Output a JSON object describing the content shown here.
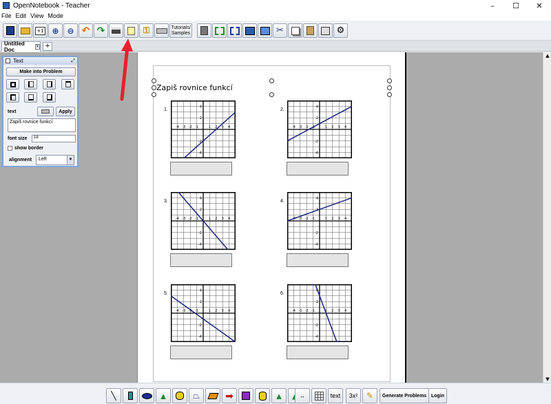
{
  "window": {
    "title": "OpenNotebook - Teacher",
    "controls": [
      "–",
      "☐",
      "✕"
    ]
  },
  "menu": [
    "File",
    "Edit",
    "View",
    "Mode"
  ],
  "toolbar": {
    "tutorials_label": "Tutorials/\nSamples"
  },
  "tabs": {
    "doc_tab": "Untitled Doc",
    "close": "x",
    "add": "+"
  },
  "panel": {
    "title": "Text",
    "make_problem": "Make into Problem",
    "text_label": "text",
    "apply": "Apply",
    "text_value": "Zapiš rovnice funkcí",
    "font_size_label": "font size",
    "font_size_value": "18",
    "show_border_label": "show border",
    "alignment_label": "alignment",
    "alignment_value": "Left"
  },
  "document": {
    "title": "Zapiš rovnice funkcí",
    "problems": [
      {
        "num": "1.",
        "slope": 1,
        "intercept": -2
      },
      {
        "num": "2.",
        "slope": 0.6,
        "intercept": 1
      },
      {
        "num": "3.",
        "slope": -1.3,
        "intercept": 0
      },
      {
        "num": "4.",
        "slope": 0.4,
        "intercept": 2
      },
      {
        "num": "5.",
        "slope": -0.8,
        "intercept": -1
      },
      {
        "num": "6.",
        "slope": -3,
        "intercept": 3
      }
    ],
    "tick_labels": [
      "-4",
      "-3",
      "-2",
      "-1",
      "1",
      "2",
      "3",
      "4"
    ]
  },
  "bottombar": {
    "text_label": "text",
    "power_label": "3x²",
    "generate": "Generate Problems",
    "login": "Login"
  },
  "colors": {
    "line": "#1a237e",
    "arrow": "#e8202a"
  }
}
